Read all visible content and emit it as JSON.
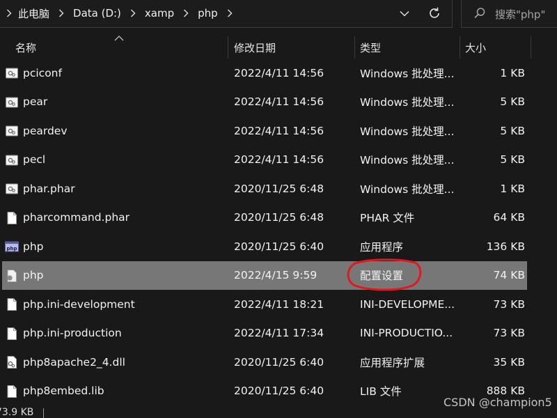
{
  "address_bar": {
    "crumbs": [
      "此电脑",
      "Data (D:)",
      "xamp",
      "php"
    ]
  },
  "search": {
    "placeholder": "搜索\"php\""
  },
  "columns": {
    "name": "名称",
    "date": "修改日期",
    "type": "类型",
    "size": "大小"
  },
  "files": [
    {
      "name": "pciconf",
      "date": "2022/4/11 14:56",
      "type": "Windows 批处理...",
      "size": "1 KB",
      "icon": "batch-file-icon"
    },
    {
      "name": "pear",
      "date": "2022/4/11 14:56",
      "type": "Windows 批处理...",
      "size": "5 KB",
      "icon": "batch-file-icon"
    },
    {
      "name": "peardev",
      "date": "2022/4/11 14:56",
      "type": "Windows 批处理...",
      "size": "5 KB",
      "icon": "batch-file-icon"
    },
    {
      "name": "pecl",
      "date": "2022/4/11 14:56",
      "type": "Windows 批处理...",
      "size": "5 KB",
      "icon": "batch-file-icon"
    },
    {
      "name": "phar.phar",
      "date": "2020/11/25 6:48",
      "type": "Windows 批处理...",
      "size": "1 KB",
      "icon": "batch-file-icon"
    },
    {
      "name": "pharcommand.phar",
      "date": "2020/11/25 6:48",
      "type": "PHAR 文件",
      "size": "64 KB",
      "icon": "blank-file-icon"
    },
    {
      "name": "php",
      "date": "2020/11/25 6:40",
      "type": "应用程序",
      "size": "136 KB",
      "icon": "php-application-icon"
    },
    {
      "name": "php",
      "date": "2022/4/15 9:59",
      "type": "配置设置",
      "size": "74 KB",
      "icon": "settings-file-icon",
      "selected": true
    },
    {
      "name": "php.ini-development",
      "date": "2022/4/11 18:21",
      "type": "INI-DEVELOPME...",
      "size": "73 KB",
      "icon": "blank-file-icon"
    },
    {
      "name": "php.ini-production",
      "date": "2022/4/11 17:34",
      "type": "INI-PRODUCTIO...",
      "size": "73 KB",
      "icon": "blank-file-icon"
    },
    {
      "name": "php8apache2_4.dll",
      "date": "2020/11/25 6:40",
      "type": "应用程序扩展",
      "size": "35 KB",
      "icon": "dll-file-icon"
    },
    {
      "name": "php8embed.lib",
      "date": "2020/11/25 6:40",
      "type": "LIB 文件",
      "size": "888 KB",
      "icon": "blank-file-icon"
    }
  ],
  "status_bar": {
    "selection_size": "73.9 KB"
  },
  "watermark": "CSDN @champion5",
  "colors": {
    "background": "#191919",
    "selection": "#777777",
    "annotation": "#e0191f"
  }
}
